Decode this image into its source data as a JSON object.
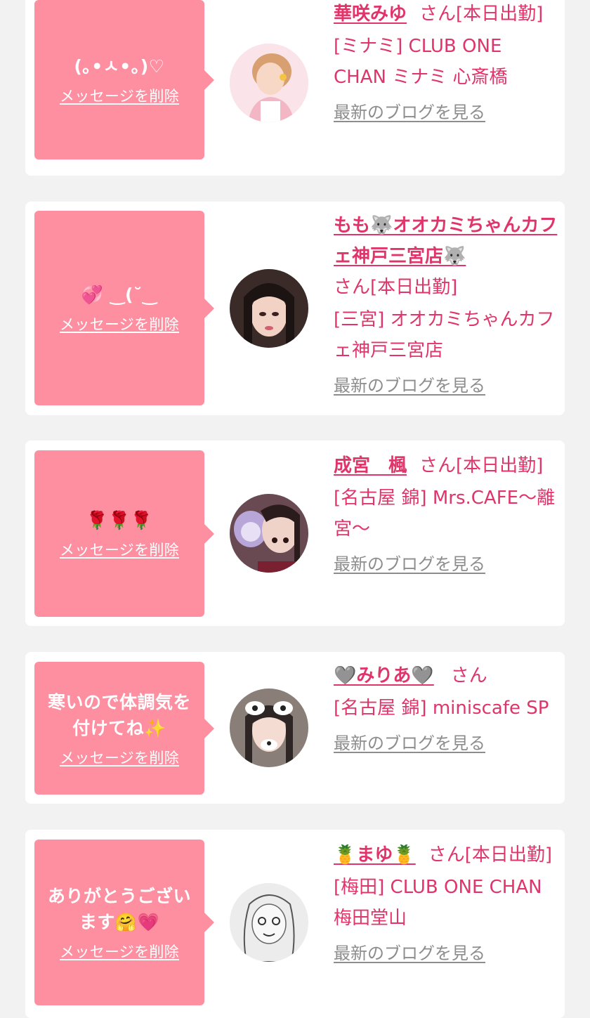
{
  "delete_label": "メッセージを削除",
  "blog_label": "最新のブログを見る",
  "colors": {
    "page_bg": "#f2f2f2",
    "bubble": "#fd8fa1",
    "accent": "#e0356a",
    "link_gray": "#8d8d8d"
  },
  "cards": [
    {
      "message": "(｡•ㅅ•｡)♡",
      "name": "華咲みゆ",
      "suffix": "さん[本日出勤]",
      "shop": "[ミナミ] CLUB ONE CHAN ミナミ 心斎橋"
    },
    {
      "message": "💞 ‿(˘‿",
      "name": "もも🐺オオカミちゃんカフェ神戸三宮店🐺",
      "suffix": "さん[本日出勤]",
      "shop": "[三宮] オオカミちゃんカフェ神戸三宮店"
    },
    {
      "message": "🌹🌹🌹",
      "name": "成宮　楓",
      "suffix": "さん[本日出勤]",
      "shop": "[名古屋 錦] Mrs.CAFE〜離宮〜"
    },
    {
      "message": "寒いので体調気を付けてね✨",
      "name": "🩶みりあ🩶",
      "suffix": "さん",
      "shop": "[名古屋 錦] miniscafe SP"
    },
    {
      "message": "ありがとうございます🤗💗",
      "name": "🍍まゆ🍍",
      "suffix": "さん[本日出勤]",
      "shop": "[梅田] CLUB ONE CHAN 梅田堂山"
    }
  ]
}
